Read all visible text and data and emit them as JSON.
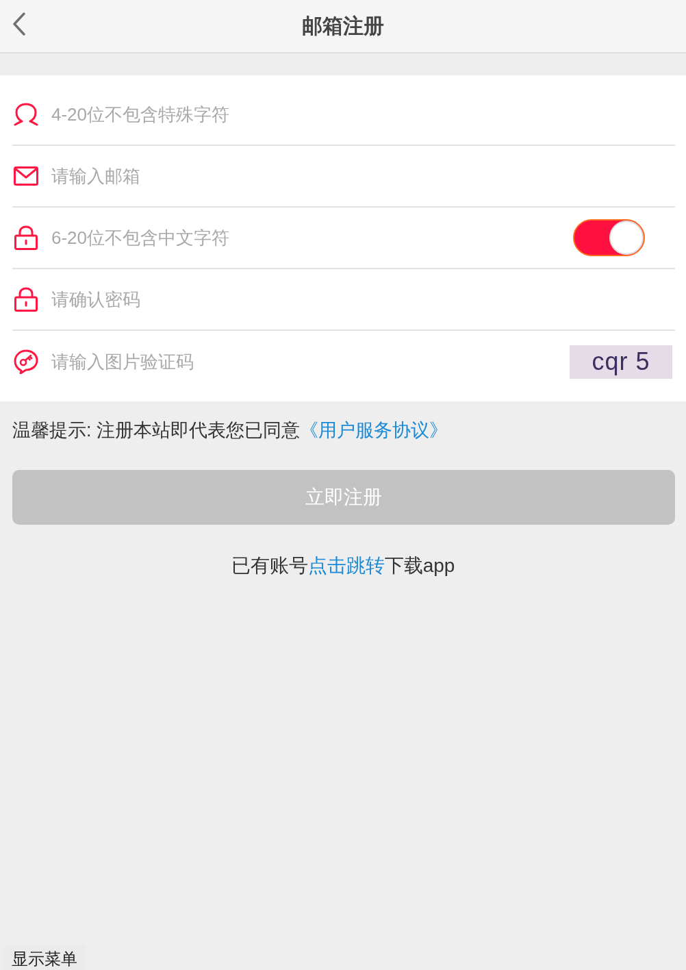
{
  "nav": {
    "title": "邮箱注册"
  },
  "fields": [
    {
      "kind": "username",
      "placeholder": "4-20位不包含特殊字符"
    },
    {
      "kind": "email",
      "placeholder": "请输入邮箱"
    },
    {
      "kind": "password",
      "placeholder": "6-20位不包含中文字符",
      "toggle": {
        "on": true
      }
    },
    {
      "kind": "password",
      "placeholder": "请确认密码"
    },
    {
      "kind": "captcha",
      "placeholder": "请输入图片验证码",
      "captcha_text": "cqr 5"
    }
  ],
  "notice": {
    "text": "温馨提示: 注册本站即代表您已同意",
    "link": "《用户服务协议》"
  },
  "submit": {
    "label": "立即注册",
    "disabled": true
  },
  "footer": {
    "before": "已有账号",
    "link": "点击跳转",
    "after": "下载app"
  },
  "menu_toggle": {
    "label": "显示菜单"
  }
}
